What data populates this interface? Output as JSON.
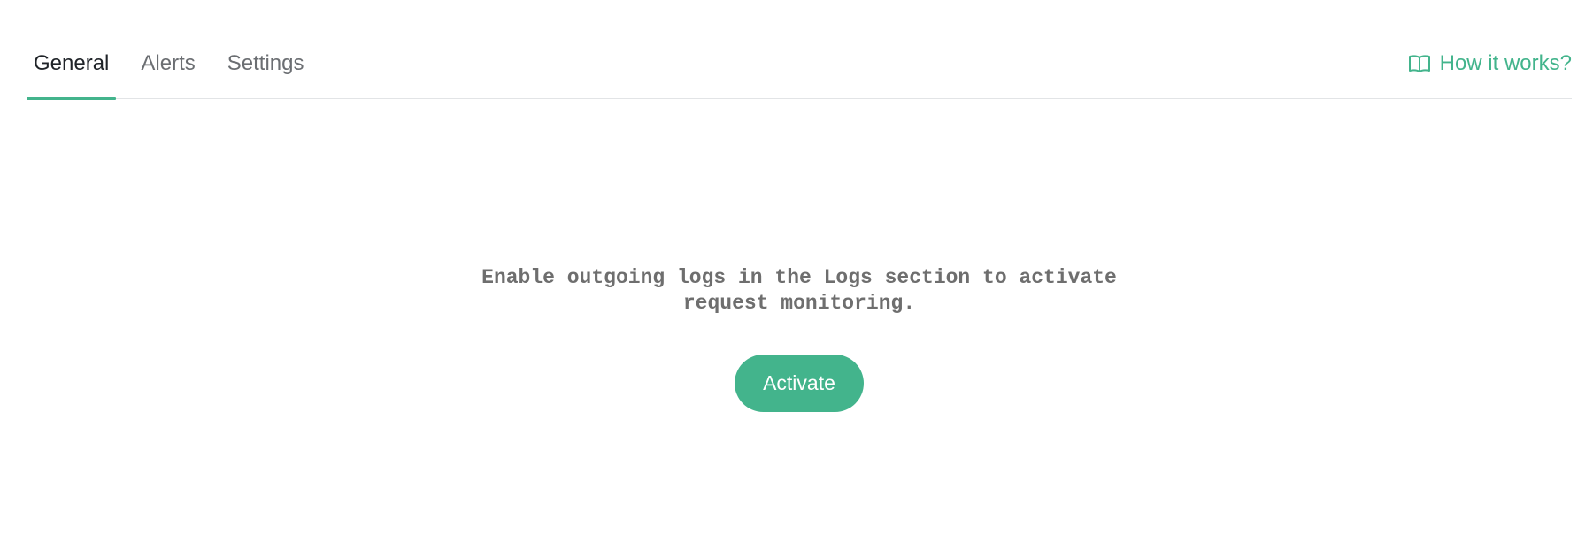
{
  "tabs": [
    {
      "label": "General",
      "active": true
    },
    {
      "label": "Alerts",
      "active": false
    },
    {
      "label": "Settings",
      "active": false
    }
  ],
  "help_link": {
    "label": "How it works?",
    "icon": "book-open-icon"
  },
  "empty_state": {
    "message_line1": "Enable outgoing logs in the Logs section to activate",
    "message_line2": "request monitoring.",
    "button_label": "Activate"
  },
  "colors": {
    "accent": "#43b48c",
    "text_active": "#1f2328",
    "text_muted": "#6b6e72",
    "message": "#6e6e6e",
    "divider": "#e2e4e6"
  }
}
